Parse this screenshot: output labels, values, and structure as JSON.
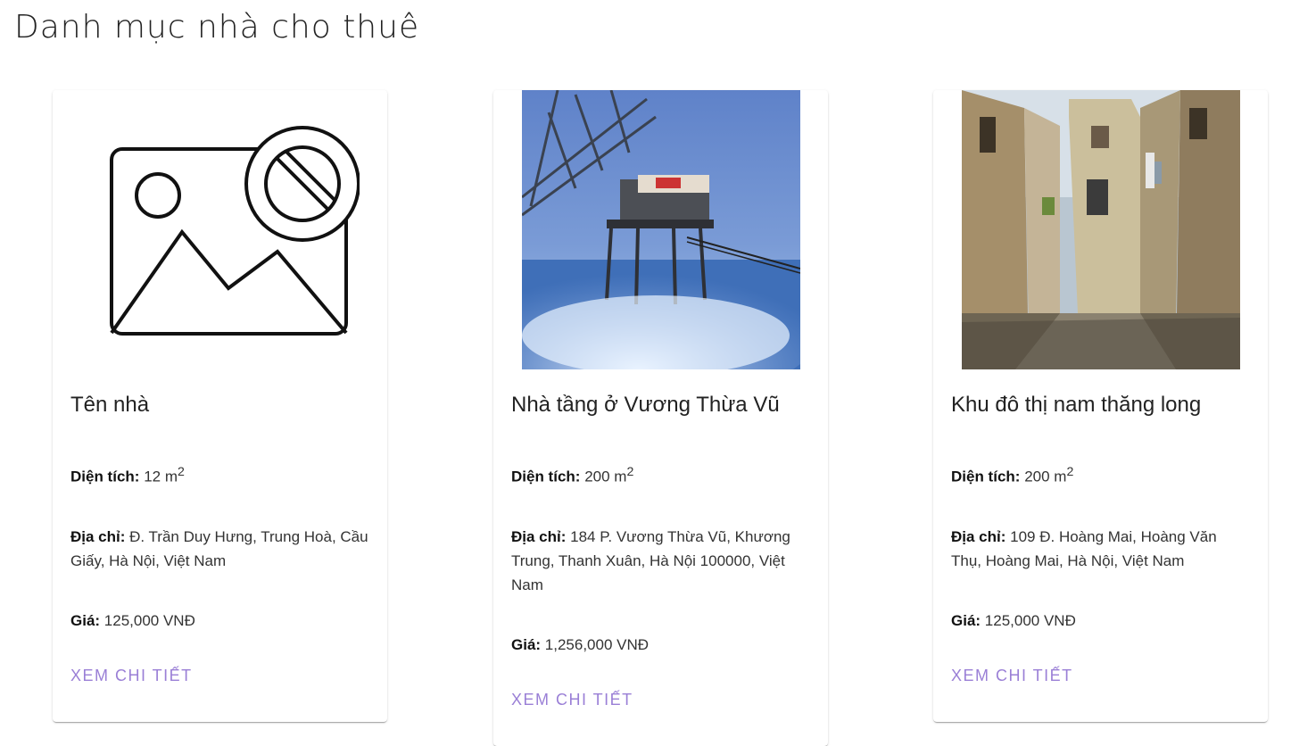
{
  "page_title": "Danh mục nhà cho thuê",
  "colors": {
    "accent": "#9a7fd6",
    "text": "#222222"
  },
  "cards": [
    {
      "image": "placeholder-broken-image-icon",
      "title": "Tên nhà",
      "area_label": "Diện tích:",
      "area_value": "12 m",
      "area_unit_sup": "2",
      "address_label": "Địa chỉ:",
      "address_value": "Đ. Trần Duy Hưng, Trung Hoà, Cầu Giấy, Hà Nội, Việt Nam",
      "price_label": "Giá:",
      "price_value": "125,000 VNĐ",
      "button": "XEM CHI TIẾT"
    },
    {
      "image": "offshore-platform-photo",
      "title": "Nhà tầng ở Vương Thừa Vũ",
      "area_label": "Diện tích:",
      "area_value": "200 m",
      "area_unit_sup": "2",
      "address_label": "Địa chỉ:",
      "address_value": "184 P. Vương Thừa Vũ, Khương Trung, Thanh Xuân, Hà Nội 100000, Việt Nam",
      "price_label": "Giá:",
      "price_value": "1,256,000 VNĐ",
      "button": "XEM CHI TIẾT"
    },
    {
      "image": "street-alley-photo",
      "title": "Khu đô thị nam thăng long",
      "area_label": "Diện tích:",
      "area_value": "200 m",
      "area_unit_sup": "2",
      "address_label": "Địa chỉ:",
      "address_value": "109 Đ. Hoàng Mai, Hoàng Văn Thụ, Hoàng Mai, Hà Nội, Việt Nam",
      "price_label": "Giá:",
      "price_value": "125,000 VNĐ",
      "button": "XEM CHI TIẾT"
    }
  ]
}
